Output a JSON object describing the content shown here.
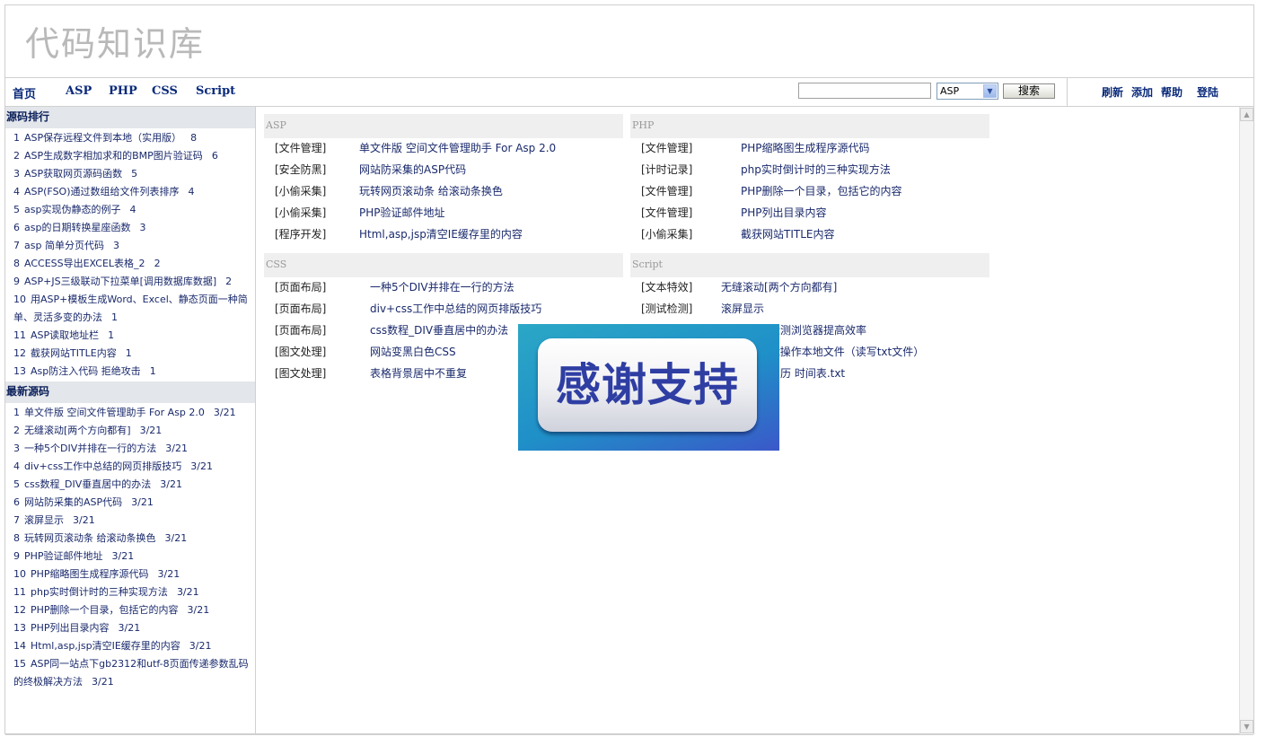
{
  "site": {
    "title": "代码知识库"
  },
  "nav": {
    "links": [
      "首页",
      "ASP",
      "PHP",
      "CSS",
      "Script"
    ],
    "search_value": "",
    "select_value": "ASP",
    "search_button": "搜索",
    "utility": [
      "刷新",
      "添加",
      "帮助",
      "登陆"
    ]
  },
  "sidebar": {
    "ranking_title": "源码排行",
    "ranking": [
      {
        "n": "1",
        "title": "ASP保存远程文件到本地（实用版）",
        "count": "8"
      },
      {
        "n": "2",
        "title": "ASP生成数字相加求和的BMP图片验证码",
        "count": "6"
      },
      {
        "n": "3",
        "title": "ASP获取网页源码函数",
        "count": "5"
      },
      {
        "n": "4",
        "title": "ASP(FSO)通过数组给文件列表排序",
        "count": "4"
      },
      {
        "n": "5",
        "title": "asp实现伪静态的例子",
        "count": "4"
      },
      {
        "n": "6",
        "title": "asp的日期转换星座函数",
        "count": "3"
      },
      {
        "n": "7",
        "title": "asp 简单分页代码",
        "count": "3"
      },
      {
        "n": "8",
        "title": "ACCESS导出EXCEL表格_2",
        "count": "2"
      },
      {
        "n": "9",
        "title": "ASP+JS三级联动下拉菜单[调用数据库数据]",
        "count": "2"
      },
      {
        "n": "10",
        "title": "用ASP+模板生成Word、Excel、静态页面一种简单、灵活多变的办法",
        "count": "1"
      },
      {
        "n": "11",
        "title": "ASP读取地址栏",
        "count": "1"
      },
      {
        "n": "12",
        "title": "截获网站TITLE内容",
        "count": "1"
      },
      {
        "n": "13",
        "title": "Asp防注入代码 拒绝攻击",
        "count": "1"
      }
    ],
    "latest_title": "最新源码",
    "latest": [
      {
        "n": "1",
        "title": "单文件版 空间文件管理助手 For Asp 2.0",
        "date": "3/21"
      },
      {
        "n": "2",
        "title": "无缝滚动[两个方向都有]",
        "date": "3/21"
      },
      {
        "n": "3",
        "title": "一种5个DIV并排在一行的方法",
        "date": "3/21"
      },
      {
        "n": "4",
        "title": "div+css工作中总结的网页排版技巧",
        "date": "3/21"
      },
      {
        "n": "5",
        "title": "css数程_DIV垂直居中的办法",
        "date": "3/21"
      },
      {
        "n": "6",
        "title": "网站防采集的ASP代码",
        "date": "3/21"
      },
      {
        "n": "7",
        "title": "滚屏显示",
        "date": "3/21"
      },
      {
        "n": "8",
        "title": "玩转网页滚动条 给滚动条换色",
        "date": "3/21"
      },
      {
        "n": "9",
        "title": "PHP验证邮件地址",
        "date": "3/21"
      },
      {
        "n": "10",
        "title": "PHP缩略图生成程序源代码",
        "date": "3/21"
      },
      {
        "n": "11",
        "title": "php实时倒计时的三种实现方法",
        "date": "3/21"
      },
      {
        "n": "12",
        "title": "PHP删除一个目录，包括它的内容",
        "date": "3/21"
      },
      {
        "n": "13",
        "title": "PHP列出目录内容",
        "date": "3/21"
      },
      {
        "n": "14",
        "title": "Html,asp,jsp清空IE缓存里的内容",
        "date": "3/21"
      },
      {
        "n": "15",
        "title": "ASP同一站点下gb2312和utf-8页面传递参数乱码的终极解决方法",
        "date": "3/21"
      }
    ]
  },
  "sections": {
    "asp": {
      "title": "ASP",
      "rows": [
        {
          "cat": "[文件管理]",
          "title": "单文件版 空间文件管理助手 For Asp 2.0"
        },
        {
          "cat": "[安全防黑]",
          "title": "网站防采集的ASP代码"
        },
        {
          "cat": "[小偷采集]",
          "title": "玩转网页滚动条 给滚动条换色"
        },
        {
          "cat": "[小偷采集]",
          "title": "PHP验证邮件地址"
        },
        {
          "cat": "[程序开发]",
          "title": "Html,asp,jsp清空IE缓存里的内容"
        }
      ]
    },
    "php": {
      "title": "PHP",
      "rows": [
        {
          "cat": "[文件管理]",
          "title": "PHP缩略图生成程序源代码"
        },
        {
          "cat": "[计时记录]",
          "title": "php实时倒计时的三种实现方法"
        },
        {
          "cat": "[文件管理]",
          "title": "PHP删除一个目录，包括它的内容"
        },
        {
          "cat": "[文件管理]",
          "title": "PHP列出目录内容"
        },
        {
          "cat": "[小偷采集]",
          "title": "截获网站TITLE内容"
        }
      ]
    },
    "css": {
      "title": "CSS",
      "rows": [
        {
          "cat": "[页面布局]",
          "title": "一种5个DIV并排在一行的方法"
        },
        {
          "cat": "[页面布局]",
          "title": "div+css工作中总结的网页排版技巧"
        },
        {
          "cat": "[页面布局]",
          "title": "css数程_DIV垂直居中的办法"
        },
        {
          "cat": "[图文处理]",
          "title": "网站变黑白色CSS"
        },
        {
          "cat": "[图文处理]",
          "title": "表格背景居中不重复"
        }
      ]
    },
    "script": {
      "title": "Script",
      "rows": [
        {
          "cat": "[文本特效]",
          "title": "无缝滚动[两个方向都有]"
        },
        {
          "cat": "[测试检测]",
          "title": "滚屏显示"
        },
        {
          "cat": "",
          "title": "检测浏览器提高效率"
        },
        {
          "cat": "",
          "title": "t操作本地文件（读写txt文件）"
        },
        {
          "cat": "",
          "title": "月历 时间表.txt"
        }
      ]
    }
  },
  "popup": {
    "text": "感谢支持"
  }
}
